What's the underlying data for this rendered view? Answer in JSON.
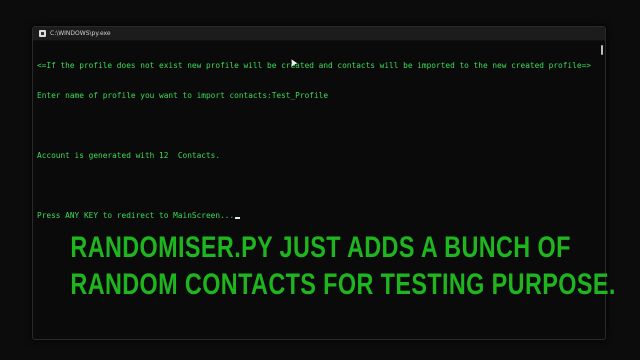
{
  "window": {
    "title": "C:\\WINDOWS\\py.exe",
    "icon": "console-app-icon"
  },
  "console": {
    "lines": [
      "<=If the profile does not exist new profile will be created and contacts will be imported to the new created profile=>",
      "Enter name of profile you want to import contacts:Test_Profile",
      "",
      "Account is generated with 12  Contacts.",
      "",
      "Press ANY KEY to redirect to MainScreen..."
    ],
    "text_color": "#3ddc5a"
  },
  "caption": {
    "line1": "RANDOMISER.PY JUST ADDS A BUNCH OF",
    "line2": "RANDOM CONTACTS FOR TESTING PURPOSE.",
    "color": "#1eb51e"
  }
}
